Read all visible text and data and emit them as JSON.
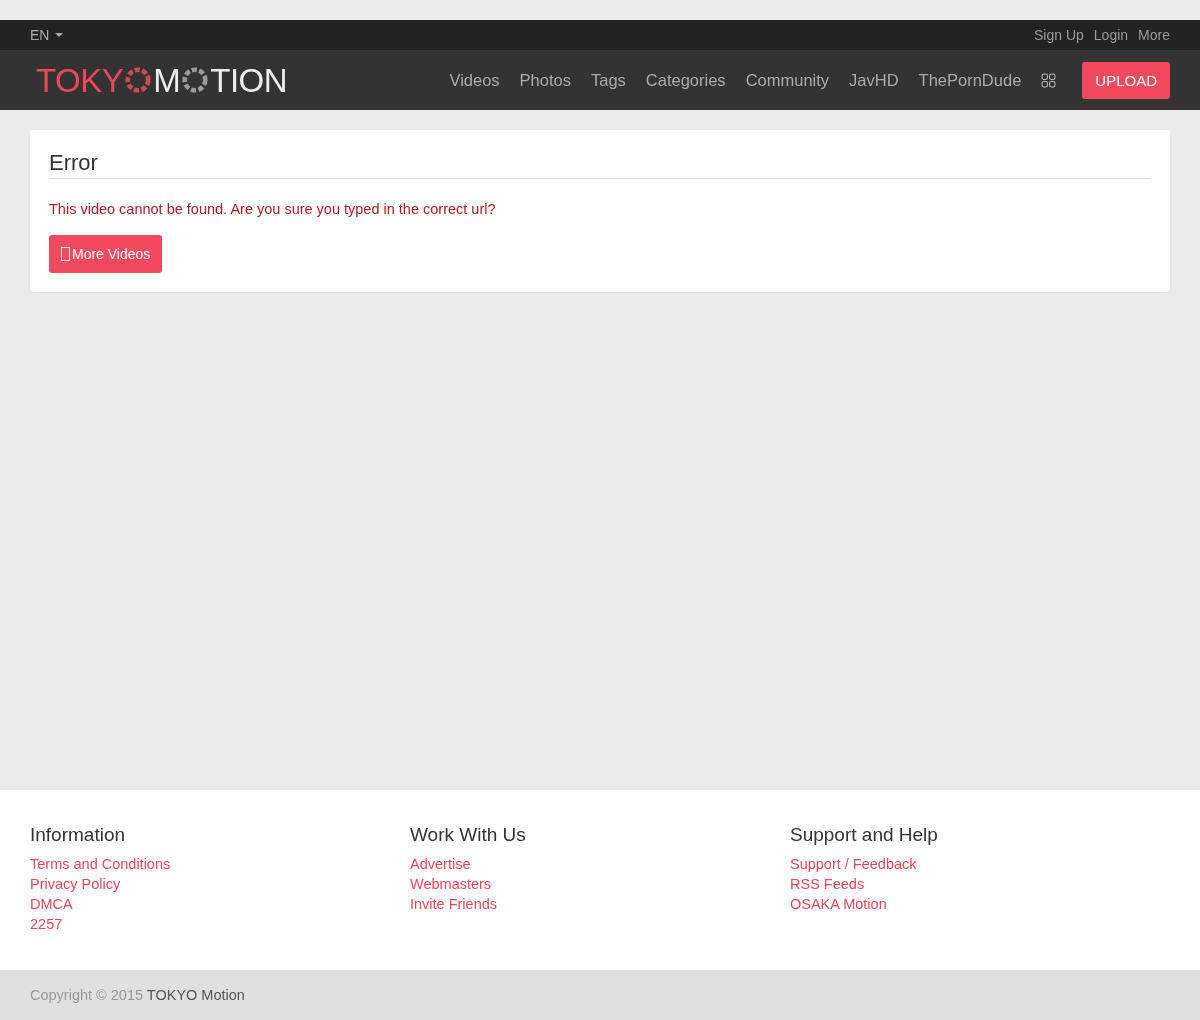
{
  "topbar": {
    "language": "EN",
    "links": [
      "Sign Up",
      "Login",
      "More"
    ]
  },
  "navbar": {
    "logo": {
      "part_1": "TOKY",
      "part_2": "M",
      "part_3": "TION"
    },
    "links": [
      "Videos",
      "Photos",
      "Tags",
      "Categories",
      "Community",
      "JavHD",
      "ThePornDude"
    ],
    "upload_button": "UPLOAD"
  },
  "error_card": {
    "title": "Error",
    "message": "This video cannot be found. Are you sure you typed in the correct url?",
    "button": "More Videos"
  },
  "footer": {
    "columns": [
      {
        "heading": "Information",
        "links": [
          "Terms and Conditions",
          "Privacy Policy",
          "DMCA",
          "2257"
        ]
      },
      {
        "heading": "Work With Us",
        "links": [
          "Advertise",
          "Webmasters",
          "Invite Friends"
        ]
      },
      {
        "heading": "Support and Help",
        "links": [
          "Support / Feedback",
          "RSS Feeds",
          "OSAKA Motion"
        ]
      }
    ]
  },
  "copyright": {
    "text": "Copyright © 2015",
    "brand": "TOKYO Motion"
  }
}
